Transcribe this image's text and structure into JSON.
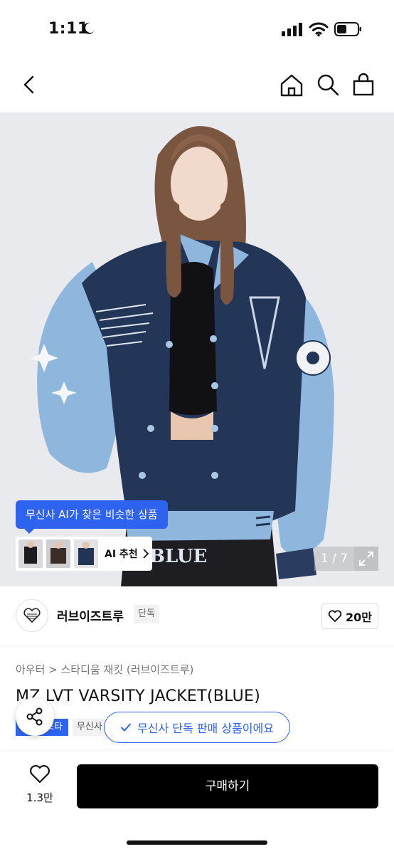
{
  "status_bar": {
    "time": "1:11"
  },
  "hero": {
    "ai_tooltip": "무신사 AI가 찾은 비슷한 상품",
    "ai_recommend_label": "AI 추천",
    "image_counter": "1 / 7"
  },
  "brand": {
    "name": "러브이즈트루",
    "tag": "단독",
    "likes": "20만"
  },
  "product": {
    "breadcrumb": "아우터 > 스타디움 재킷 (러브이즈트루)",
    "title": "MZ LVT VARSITY JACKET(BLUE)",
    "badge_blue": "스타",
    "badge_gray": "무신사",
    "exclusive_notice": "무신사 단독 판매 상품이에요"
  },
  "bottom": {
    "fav_count": "1.3만",
    "buy_label": "구매하기"
  },
  "colors": {
    "accent": "#2e63f0",
    "jacket_navy": "#233657",
    "sleeve_blue": "#8fb6dc"
  }
}
